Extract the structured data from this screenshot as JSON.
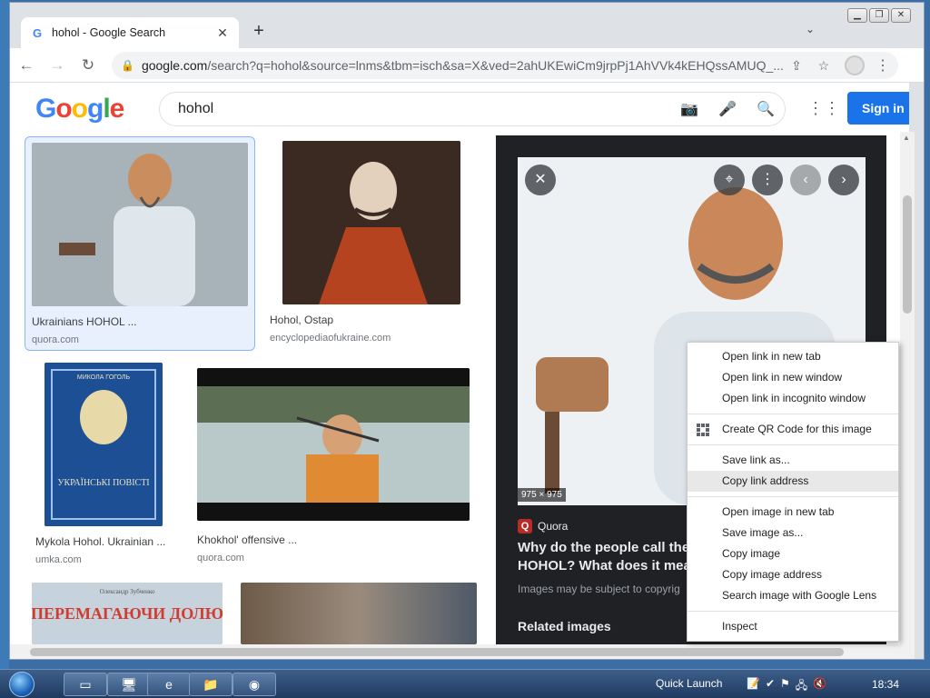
{
  "browser": {
    "tab_title": "hohol - Google Search",
    "tab_favicon": "G",
    "new_tab": "+",
    "url_main": "google.com",
    "url_rest": "/search?q=hohol&source=lnms&tbm=isch&sa=X&ved=2ahUKEwiCm9jrpPj1AhVVk4kEHQssAMUQ_..."
  },
  "google": {
    "logo_letters": [
      "G",
      "o",
      "o",
      "g",
      "l",
      "e"
    ],
    "query": "hohol",
    "sign_in": "Sign in"
  },
  "results": [
    {
      "caption": "Ukrainians HOHOL ...",
      "source": "quora.com"
    },
    {
      "caption": "Hohol, Ostap",
      "source": "encyclopediaofukraine.com"
    },
    {
      "caption": "Mykola Hohol. Ukrainian ...",
      "source": "umka.com"
    },
    {
      "caption": "Khokhol' offensive ...",
      "source": "quora.com"
    }
  ],
  "thumb_texts": {
    "book_author": "МИКОЛА ГОГОЛЬ",
    "book_title": "УКРАЇНСЬКІ ПОВІСТІ",
    "book2_author": "Олександр Зубченко",
    "book2_title": "ПЕРЕМАГАЮЧИ ДОЛЮ"
  },
  "panel": {
    "size_badge": "975 × 975",
    "source": "Quora",
    "headline": "Why do the people call the U HOHOL? What does it mean",
    "note": "Images may be subject to copyrig",
    "related": "Related images"
  },
  "context_menu": {
    "group1": [
      "Open link in new tab",
      "Open link in new window",
      "Open link in incognito window"
    ],
    "qr": "Create QR Code for this image",
    "group2": [
      "Save link as...",
      "Copy link address"
    ],
    "group3": [
      "Open image in new tab",
      "Save image as...",
      "Copy image",
      "Copy image address",
      "Search image with Google Lens"
    ],
    "inspect": "Inspect"
  },
  "taskbar": {
    "quick_launch": "Quick Launch",
    "clock": "18:34"
  }
}
